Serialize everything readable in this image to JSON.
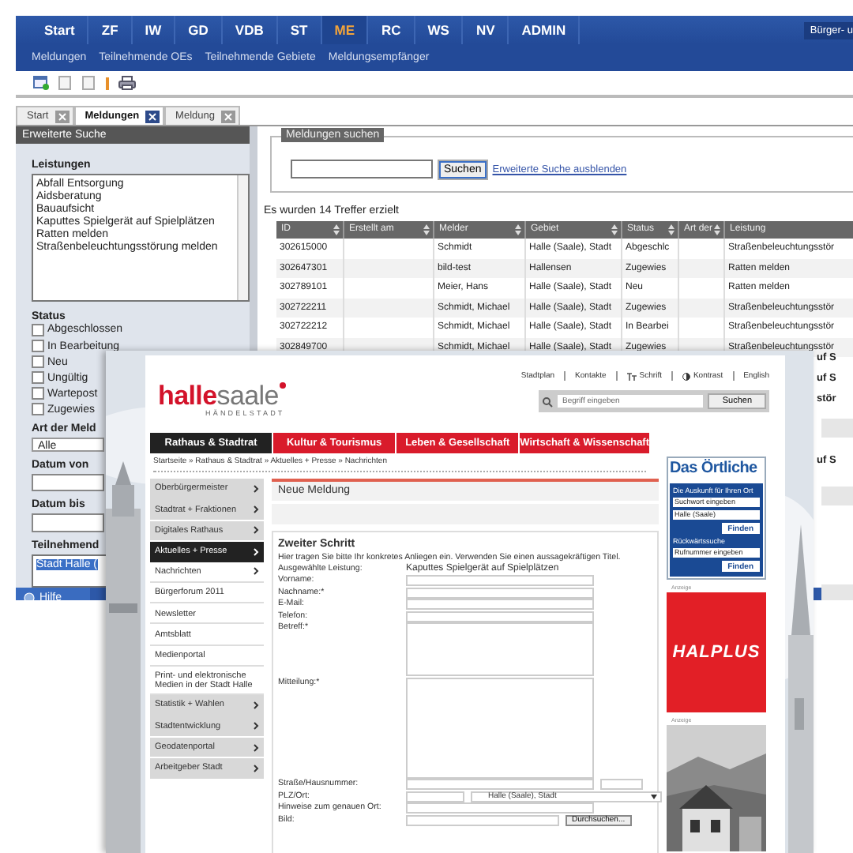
{
  "app": {
    "main_nav": [
      {
        "label": "Start",
        "selected": false
      },
      {
        "label": "ZF",
        "selected": false
      },
      {
        "label": "IW",
        "selected": false
      },
      {
        "label": "GD",
        "selected": false
      },
      {
        "label": "VDB",
        "selected": false
      },
      {
        "label": "ST",
        "selected": false
      },
      {
        "label": "ME",
        "selected": true
      },
      {
        "label": "RC",
        "selected": false
      },
      {
        "label": "WS",
        "selected": false
      },
      {
        "label": "NV",
        "selected": false
      },
      {
        "label": "ADMIN",
        "selected": false
      }
    ],
    "user_label": "Bürger- u",
    "sub_nav": [
      "Meldungen",
      "Teilnehmende OEs",
      "Teilnehmende Gebiete",
      "Meldungsempfänger"
    ],
    "tabs": [
      {
        "label": "Start",
        "selected": false
      },
      {
        "label": "Meldungen",
        "selected": true
      },
      {
        "label": "Meldung",
        "selected": false
      }
    ],
    "filter_panel": {
      "title": "Erweiterte Suche",
      "leistungen_label": "Leistungen",
      "leistungen": [
        "Abfall Entsorgung",
        "Aidsberatung",
        "Bauaufsicht",
        "Kaputtes Spielgerät auf Spielplätzen",
        "Ratten melden",
        "Straßenbeleuchtungsstörung melden"
      ],
      "status_label": "Status",
      "status_options": [
        {
          "label": "Abgeschlossen",
          "checked": false
        },
        {
          "label": "In Bearbeitung",
          "checked": false
        },
        {
          "label": "Neu",
          "checked": false
        },
        {
          "label": "Ungültig",
          "checked": false
        },
        {
          "label": "Wartepost",
          "checked": false
        },
        {
          "label": "Zugewies",
          "checked": false
        }
      ],
      "art_label": "Art der Meld",
      "art_value": "Alle",
      "date_from_label": "Datum von",
      "date_to_label": "Datum bis",
      "teilnehmende_label": "Teilnehmend",
      "teilnehmende": [
        {
          "label": "Stadt Halle (",
          "selected": true
        }
      ]
    },
    "search": {
      "legend": "Meldungen suchen",
      "button": "Suchen",
      "link": "Erweiterte Suche ausblenden"
    },
    "result_count": "Es wurden 14 Treffer erzielt",
    "table": {
      "columns": [
        "ID",
        "Erstellt am",
        "Melder",
        "Gebiet",
        "Status",
        "Art der",
        "Leistung"
      ],
      "rows": [
        {
          "id": "302615000",
          "melder": "Schmidt",
          "gebiet": "Halle (Saale), Stadt",
          "status": "Abgeschlc",
          "leistung": "Straßenbeleuchtungsstör"
        },
        {
          "id": "302647301",
          "melder": "bild-test",
          "gebiet": "Hallensen",
          "status": "Zugewies",
          "leistung": "Ratten melden"
        },
        {
          "id": "302789101",
          "melder": "Meier, Hans",
          "gebiet": "Halle (Saale), Stadt",
          "status": "Neu",
          "leistung": "Ratten melden"
        },
        {
          "id": "302722211",
          "melder": "Schmidt, Michael",
          "gebiet": "Halle (Saale), Stadt",
          "status": "Zugewies",
          "leistung": "Straßenbeleuchtungsstör"
        },
        {
          "id": "302722212",
          "melder": "Schmidt, Michael",
          "gebiet": "Halle (Saale), Stadt",
          "status": "In Bearbei",
          "leistung": "Straßenbeleuchtungsstör"
        },
        {
          "id": "302849700",
          "melder": "Schmidt, Michael",
          "gebiet": "Halle (Saale), Stadt",
          "status": "Zugewies",
          "leistung": "Straßenbeleuchtungsstör"
        }
      ]
    },
    "edge_fragments": [
      "uf S",
      "uf S",
      "stör",
      "uf S"
    ],
    "status_bar": {
      "button": "Hilfe"
    }
  },
  "site": {
    "top_links": [
      {
        "label": "Stadtplan",
        "kind": "plain"
      },
      {
        "label": "Kontakte",
        "kind": "plain"
      },
      {
        "label": "Schrift",
        "kind": "font"
      },
      {
        "label": "Kontrast",
        "kind": "contrast"
      },
      {
        "label": "English",
        "kind": "plain"
      }
    ],
    "logo": {
      "first": "halle",
      "second": "saale",
      "tagline": "HÄNDELSTADT"
    },
    "search": {
      "placeholder": "Begriff eingeben",
      "button": "Suchen"
    },
    "main_nav": [
      {
        "label": "Rathaus & Stadtrat",
        "selected": true
      },
      {
        "label": "Kultur & Tourismus",
        "selected": false
      },
      {
        "label": "Leben & Gesellschaft",
        "selected": false
      },
      {
        "label": "Wirtschaft & Wissenschaft",
        "selected": false
      }
    ],
    "breadcrumb": "Startseite » Rathaus & Stadtrat » Aktuelles + Presse » Nachrichten",
    "side_menu": [
      {
        "label": "Oberbürgermeister",
        "kind": "section",
        "selected": false,
        "submenu": true
      },
      {
        "label": "Stadtrat + Fraktionen",
        "kind": "section",
        "selected": false,
        "submenu": true
      },
      {
        "label": "Digitales Rathaus",
        "kind": "section",
        "selected": false,
        "submenu": true
      },
      {
        "label": "Aktuelles + Presse",
        "kind": "section",
        "selected": true,
        "submenu": true
      },
      {
        "label": "Nachrichten",
        "kind": "sub",
        "selected": false,
        "submenu": true
      },
      {
        "label": "Bürgerforum 2011",
        "kind": "sub",
        "selected": false,
        "submenu": false
      },
      {
        "label": "Newsletter",
        "kind": "sub",
        "selected": false,
        "submenu": false
      },
      {
        "label": "Amtsblatt",
        "kind": "sub",
        "selected": false,
        "submenu": false
      },
      {
        "label": "Medienportal",
        "kind": "sub",
        "selected": false,
        "submenu": false
      },
      {
        "label": "Print- und elektronische Medien in der Stadt Halle",
        "kind": "sub",
        "selected": false,
        "submenu": false
      },
      {
        "label": "Statistik + Wahlen",
        "kind": "section",
        "selected": false,
        "submenu": true
      },
      {
        "label": "Stadtentwicklung",
        "kind": "section",
        "selected": false,
        "submenu": true
      },
      {
        "label": "Geodatenportal",
        "kind": "section",
        "selected": false,
        "submenu": true
      },
      {
        "label": "Arbeitgeber Stadt",
        "kind": "section",
        "selected": false,
        "submenu": true
      }
    ],
    "content": {
      "title": "Neue Meldung",
      "step": "Zweiter Schritt",
      "intro": "Hier tragen Sie bitte Ihr konkretes Anliegen ein. Verwenden Sie einen aussagekräftigen Titel.",
      "fields": [
        {
          "label": "Ausgewählte Leistung:",
          "kind": "text",
          "value": "Kaputtes Spielgerät auf Spielplätzen"
        },
        {
          "label": "Vorname:",
          "kind": "input"
        },
        {
          "label": "Nachname:*",
          "kind": "input"
        },
        {
          "label": "E-Mail:",
          "kind": "input"
        },
        {
          "label": "Telefon:",
          "kind": "input"
        },
        {
          "label": "Betreff:*",
          "kind": "textarea"
        },
        {
          "label": "Mitteilung:*",
          "kind": "bigtext"
        },
        {
          "label": "Straße/Hausnummer:",
          "kind": "pair"
        },
        {
          "label": "PLZ/Ort:",
          "kind": "select",
          "value": "Halle (Saale), Stadt"
        },
        {
          "label": "Hinweise zum genauen Ort:",
          "kind": "input"
        },
        {
          "label": "Bild:",
          "kind": "file",
          "button": "Durchsuchen..."
        }
      ]
    },
    "sidebar": {
      "title": "Das Örtliche",
      "caption": "Die Auskunft für Ihren Ort",
      "search_placeholder": "Suchwort eingeben",
      "place_value": "Halle (Saale)",
      "find_button": "Finden",
      "reverse_label": "Rückwärtssuche",
      "phone_placeholder": "Rufnummer eingeben",
      "reverse_button": "Finden",
      "ad_label": "Anzeige",
      "ad_text": "HALPLUS",
      "photo_label": "Anzeige"
    }
  }
}
